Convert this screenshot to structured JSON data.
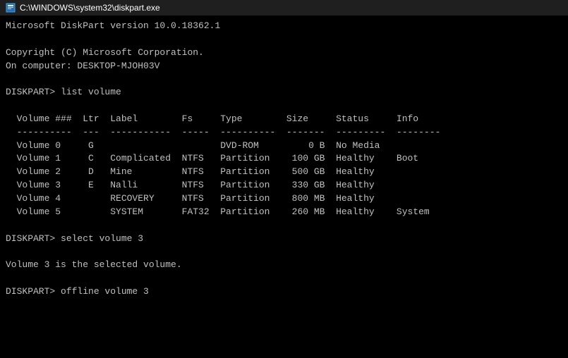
{
  "titlebar": {
    "icon": "▣",
    "title": "C:\\WINDOWS\\system32\\diskpart.exe"
  },
  "terminal": {
    "lines": [
      "Microsoft DiskPart version 10.0.18362.1",
      "",
      "Copyright (C) Microsoft Corporation.",
      "On computer: DESKTOP-MJOH03V",
      "",
      "DISKPART> list volume",
      "",
      "  Volume ###  Ltr  Label        Fs     Type        Size     Status     Info",
      "  ----------  ---  -----------  -----  ----------  -------  ---------  --------",
      "  Volume 0     G                       DVD-ROM         0 B  No Media",
      "  Volume 1     C   Complicated  NTFS   Partition    100 GB  Healthy    Boot",
      "  Volume 2     D   Mine         NTFS   Partition    500 GB  Healthy",
      "  Volume 3     E   Nalli        NTFS   Partition    330 GB  Healthy",
      "  Volume 4         RECOVERY     NTFS   Partition    800 MB  Healthy",
      "  Volume 5         SYSTEM       FAT32  Partition    260 MB  Healthy    System",
      "",
      "DISKPART> select volume 3",
      "",
      "Volume 3 is the selected volume.",
      "",
      "DISKPART> offline volume 3"
    ]
  }
}
